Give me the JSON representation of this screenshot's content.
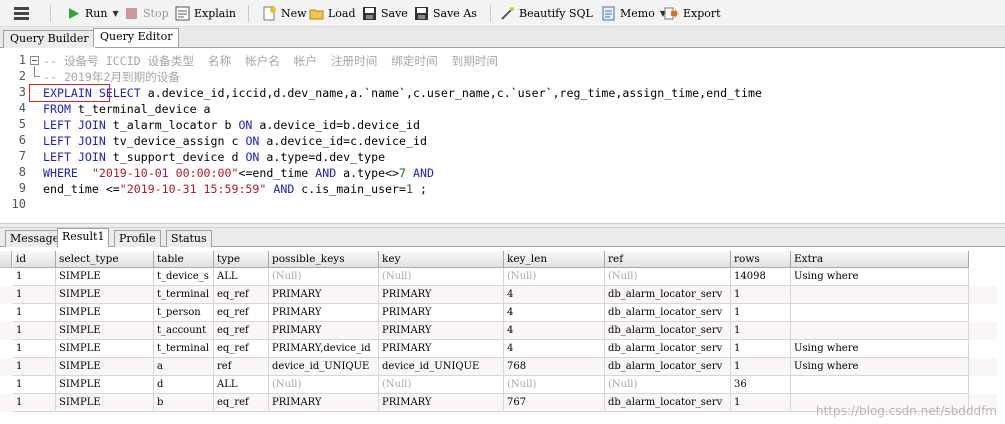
{
  "toolbar": {
    "run": "Run",
    "stop": "Stop",
    "explain": "Explain",
    "new": "New",
    "load": "Load",
    "save": "Save",
    "save_as": "Save As",
    "beautify": "Beautify SQL",
    "memo": "Memo",
    "export": "Export"
  },
  "tabs": [
    "Query Builder",
    "Query Editor"
  ],
  "editor": {
    "line_numbers": [
      "1",
      "2",
      "3",
      "4",
      "5",
      "6",
      "7",
      "8",
      "9",
      "10"
    ],
    "line1": "-- 设备号 ICCID 设备类型  名称  帐户名  帐户  注册时间  绑定时间  到期时间",
    "line2": "-- 2019年2月到期的设备",
    "line3": {
      "kw1": "EXPLAIN",
      "kw2": "SELECT",
      "rest": " a.device_id,iccid,d.dev_name,a.`name`,c.user_name,c.`user`,reg_time,assign_time,end_time"
    },
    "line4": {
      "kw": "FROM",
      "rest": " t_terminal_device a"
    },
    "line5": {
      "kw": "LEFT JOIN",
      "mid": " t_alarm_locator b ",
      "on": "ON",
      "rest": " a.device_id=b.device_id"
    },
    "line6": {
      "kw": "LEFT JOIN",
      "mid": " tv_device_assign c ",
      "on": "ON",
      "rest": " a.device_id=c.device_id"
    },
    "line7": {
      "kw": "LEFT JOIN",
      "mid": " t_support_device d ",
      "on": "ON",
      "rest": " a.type=d.dev_type"
    },
    "line8": {
      "kw": "WHERE",
      "sp": "  ",
      "str": "\"2019-10-01 00:00:00\"",
      "mid": "<=end_time ",
      "and1": "AND",
      "mid2": " a.type<>",
      "num": "7",
      "sp2": " ",
      "and2": "AND"
    },
    "line9": {
      "a": "end_time <=",
      "str": "\"2019-10-31 15:59:59\"",
      "sp": " ",
      "and": "AND",
      "mid": " c.is_main_user=",
      "num": "1",
      "end": " ;"
    }
  },
  "result_tabs": [
    "Message",
    "Result1",
    "Profile",
    "Status"
  ],
  "grid": {
    "columns": [
      "id",
      "select_type",
      "table",
      "type",
      "possible_keys",
      "key",
      "key_len",
      "ref",
      "rows",
      "Extra"
    ],
    "rows": [
      [
        "1",
        "SIMPLE",
        "t_device_s",
        "ALL",
        "(Null)",
        "(Null)",
        "(Null)",
        "(Null)",
        "14098",
        "Using where"
      ],
      [
        "1",
        "SIMPLE",
        "t_terminal",
        "eq_ref",
        "PRIMARY",
        "PRIMARY",
        "4",
        "db_alarm_locator_serv",
        "1",
        ""
      ],
      [
        "1",
        "SIMPLE",
        "t_person",
        "eq_ref",
        "PRIMARY",
        "PRIMARY",
        "4",
        "db_alarm_locator_serv",
        "1",
        ""
      ],
      [
        "1",
        "SIMPLE",
        "t_account",
        "eq_ref",
        "PRIMARY",
        "PRIMARY",
        "4",
        "db_alarm_locator_serv",
        "1",
        ""
      ],
      [
        "1",
        "SIMPLE",
        "t_terminal",
        "eq_ref",
        "PRIMARY,device_id",
        "PRIMARY",
        "4",
        "db_alarm_locator_serv",
        "1",
        "Using where"
      ],
      [
        "1",
        "SIMPLE",
        "a",
        "ref",
        "device_id_UNIQUE",
        "device_id_UNIQUE",
        "768",
        "db_alarm_locator_serv",
        "1",
        "Using where"
      ],
      [
        "1",
        "SIMPLE",
        "d",
        "ALL",
        "(Null)",
        "(Null)",
        "(Null)",
        "(Null)",
        "36",
        ""
      ],
      [
        "1",
        "SIMPLE",
        "b",
        "eq_ref",
        "PRIMARY",
        "PRIMARY",
        "767",
        "db_alarm_locator_serv",
        "1",
        ""
      ]
    ]
  },
  "watermark": "https://blog.csdn.net/sbdddfm",
  "colors": {
    "keyword": "#1a22c8",
    "string": "#b0182c",
    "number": "#107010",
    "comment": "#a6a6a6",
    "highlight_box": "#e02020"
  }
}
